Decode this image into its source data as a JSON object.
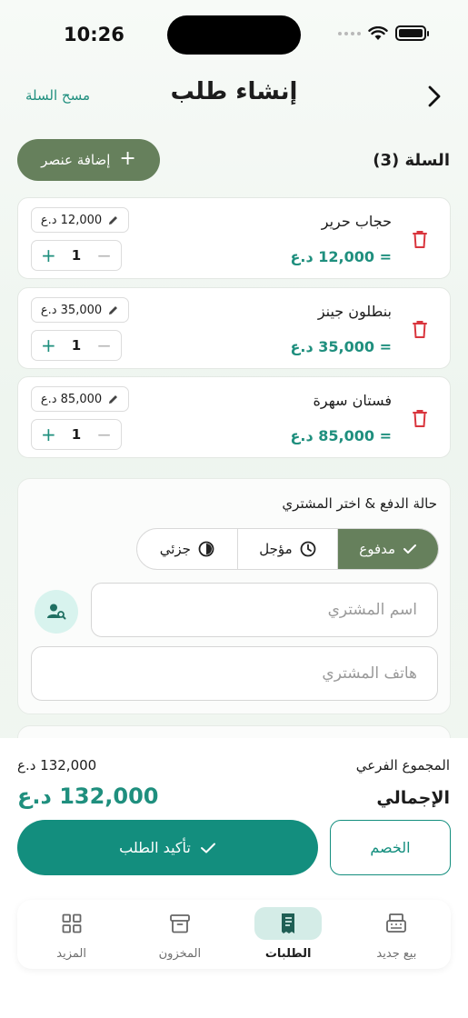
{
  "status": {
    "time": "10:26"
  },
  "header": {
    "title": "إنشاء طلب",
    "clear_cart": "مسح السلة"
  },
  "cart": {
    "title": "السلة (3)",
    "add_item_label": "إضافة عنصر",
    "items": [
      {
        "name": "حجاب حرير",
        "price": "12,000 د.ع",
        "qty": "1",
        "total": "= 12,000 د.ع"
      },
      {
        "name": "بنطلون جينز",
        "price": "35,000 د.ع",
        "qty": "1",
        "total": "= 35,000 د.ع"
      },
      {
        "name": "فستان سهرة",
        "price": "85,000 د.ع",
        "qty": "1",
        "total": "= 85,000 د.ع"
      }
    ]
  },
  "payment": {
    "title": "حالة الدفع & اختر المشتري",
    "options": [
      {
        "label": "مدفوع",
        "active": true
      },
      {
        "label": "مؤجل",
        "active": false
      },
      {
        "label": "جزئي",
        "active": false
      }
    ],
    "buyer_name_placeholder": "اسم المشتري",
    "buyer_phone_placeholder": "هاتف المشتري"
  },
  "summary": {
    "subtotal_label": "المجموع الفرعي",
    "subtotal_value": "132,000 د.ع",
    "total_label": "الإجمالي",
    "total_value": "132,000 د.ع",
    "confirm_label": "تأكيد الطلب",
    "discount_label": "الخصم"
  },
  "tabs": [
    {
      "label": "بيع جديد",
      "icon": "cash-register-icon"
    },
    {
      "label": "الطلبات",
      "icon": "receipt-icon",
      "active": true
    },
    {
      "label": "المخزون",
      "icon": "archive-box-icon"
    },
    {
      "label": "المزيد",
      "icon": "grid-icon"
    }
  ],
  "colors": {
    "accent": "#138e7e",
    "olive": "#66805c",
    "danger": "#d9363e"
  }
}
